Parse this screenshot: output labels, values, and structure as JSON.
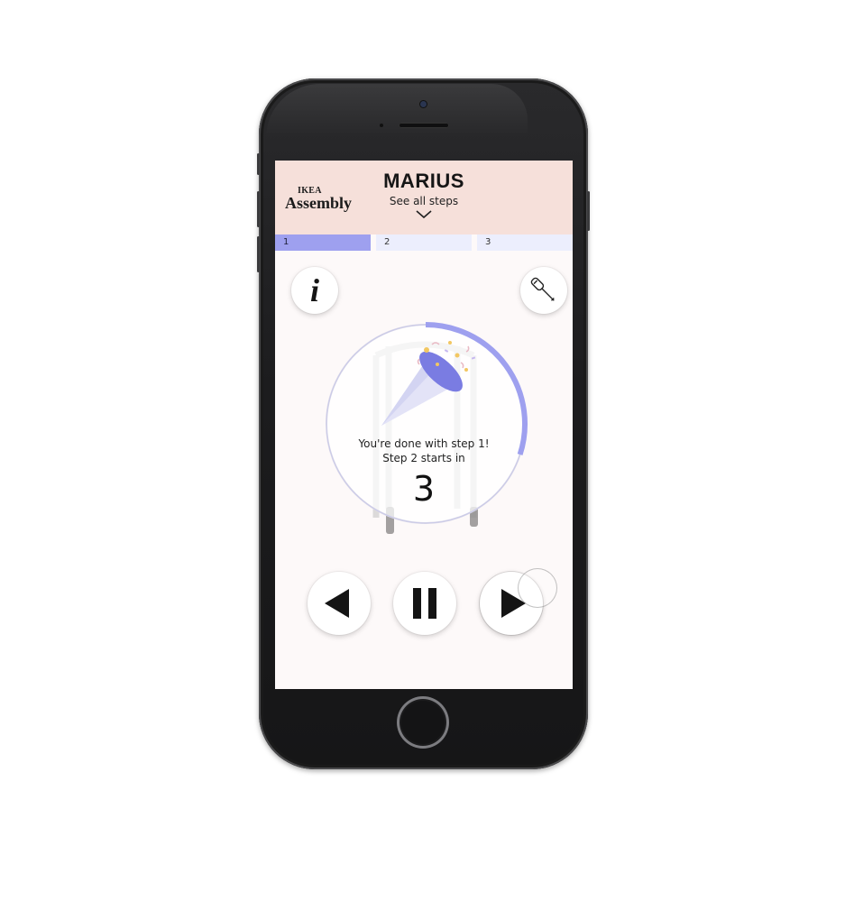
{
  "app": {
    "logo_top": "IKEA",
    "logo_main": "Assembly",
    "product_name": "MARIUS",
    "see_all_steps": "See all steps"
  },
  "steps": [
    {
      "label": "1",
      "active": true
    },
    {
      "label": "2",
      "active": false
    },
    {
      "label": "3",
      "active": false
    }
  ],
  "countdown": {
    "done_message": "You're done with step 1!",
    "next_message": "Step 2 starts in",
    "seconds": "3",
    "progress_fraction": 0.3
  },
  "controls": {
    "info_glyph": "i",
    "icons": [
      "info-icon",
      "screwdriver-icon",
      "previous-icon",
      "pause-icon",
      "next-icon",
      "party-popper-icon",
      "chevron-down-icon"
    ]
  },
  "colors": {
    "header_bg": "#f6e0da",
    "accent": "#9ea0ef",
    "screen_bg": "#fdf9f9"
  }
}
